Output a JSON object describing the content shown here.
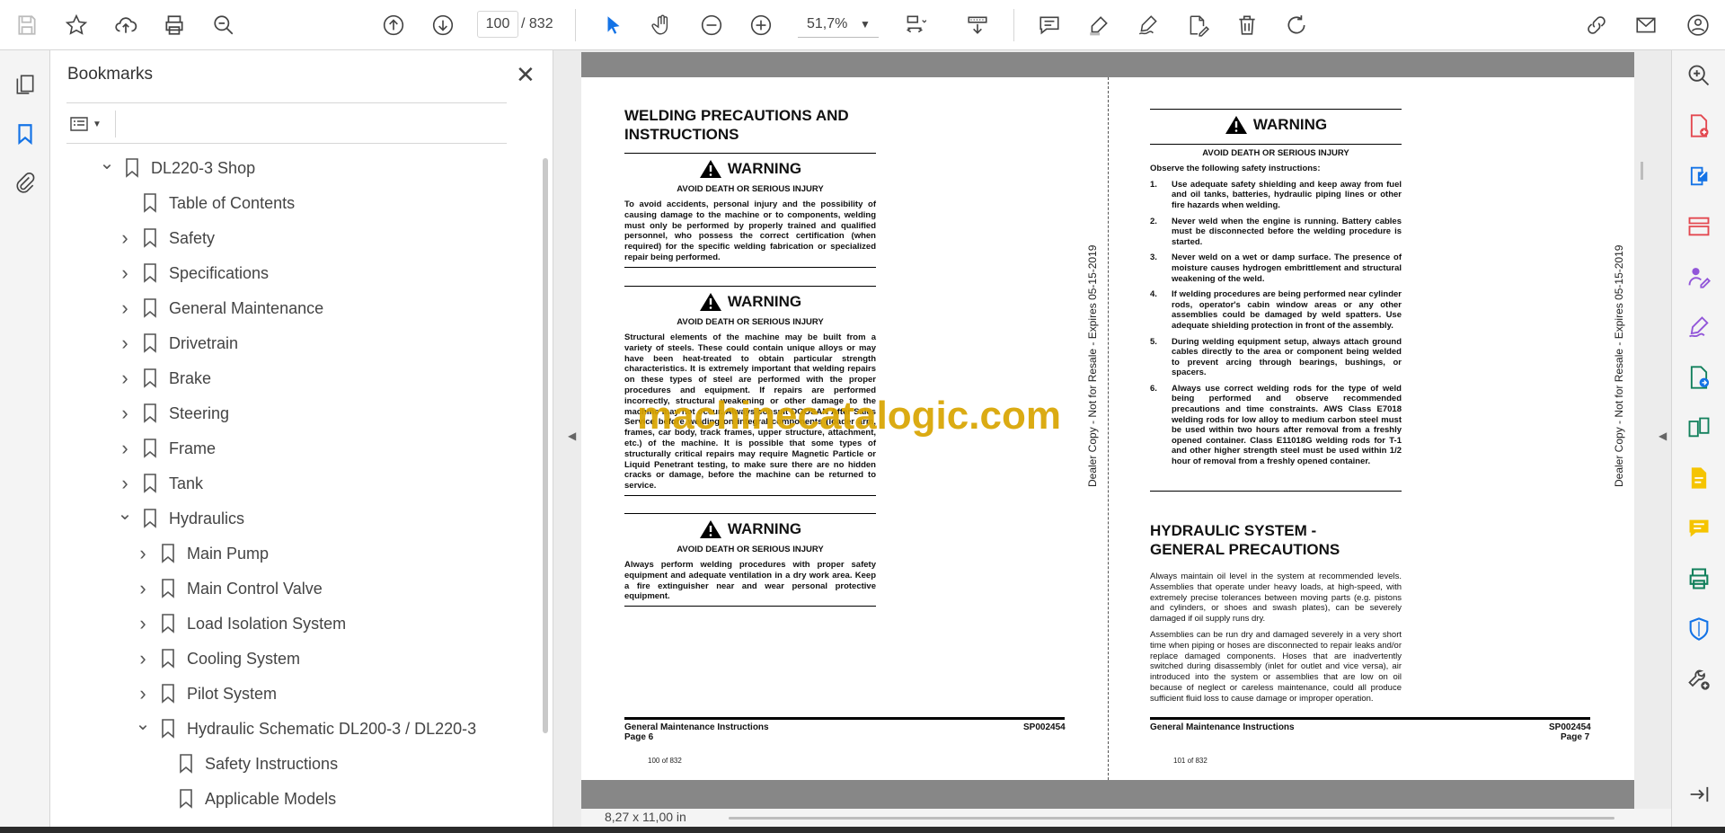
{
  "toolbar": {
    "page_current": "100",
    "page_total": "/ 832",
    "zoom": "51,7%",
    "tools": [
      "save-icon",
      "star-icon",
      "upload-icon",
      "print-icon",
      "zoom-search-icon",
      "prev-page-icon",
      "next-page-icon",
      "select-arrow-icon",
      "hand-icon",
      "zoom-out-icon",
      "zoom-in-icon",
      "fit-page-icon",
      "scroll-mode-icon",
      "comment-icon",
      "highlight-icon",
      "sign-icon",
      "fill-sign-icon",
      "delete-icon",
      "rotate-icon",
      "share-link-icon",
      "mail-icon",
      "account-icon"
    ]
  },
  "bookmarks": {
    "title": "Bookmarks",
    "items": [
      {
        "label": "DL220-3 Shop",
        "level": 0,
        "state": "expanded"
      },
      {
        "label": "Table of Contents",
        "level": 1,
        "state": "leaf"
      },
      {
        "label": "Safety",
        "level": 1,
        "state": "collapsed"
      },
      {
        "label": "Specifications",
        "level": 1,
        "state": "collapsed"
      },
      {
        "label": "General Maintenance",
        "level": 1,
        "state": "collapsed"
      },
      {
        "label": "Drivetrain",
        "level": 1,
        "state": "collapsed"
      },
      {
        "label": "Brake",
        "level": 1,
        "state": "collapsed"
      },
      {
        "label": "Steering",
        "level": 1,
        "state": "collapsed"
      },
      {
        "label": "Frame",
        "level": 1,
        "state": "collapsed"
      },
      {
        "label": "Tank",
        "level": 1,
        "state": "collapsed"
      },
      {
        "label": "Hydraulics",
        "level": 1,
        "state": "expanded"
      },
      {
        "label": "Main Pump",
        "level": 2,
        "state": "collapsed"
      },
      {
        "label": "Main Control Valve",
        "level": 2,
        "state": "collapsed"
      },
      {
        "label": "Load Isolation System",
        "level": 2,
        "state": "collapsed"
      },
      {
        "label": "Cooling System",
        "level": 2,
        "state": "collapsed"
      },
      {
        "label": "Pilot System",
        "level": 2,
        "state": "collapsed"
      },
      {
        "label": "Hydraulic Schematic DL200-3 / DL220-3",
        "level": 2,
        "state": "expanded"
      },
      {
        "label": "Safety Instructions",
        "level": 3,
        "state": "leaf"
      },
      {
        "label": "Applicable Models",
        "level": 3,
        "state": "leaf"
      }
    ]
  },
  "doc": {
    "left": {
      "title_line1": "WELDING PRECAUTIONS AND",
      "title_line2": "INSTRUCTIONS",
      "warnings": [
        {
          "head": "WARNING",
          "sub": "AVOID DEATH OR SERIOUS INJURY",
          "body": "To avoid accidents, personal injury and the possibility of causing damage to the machine or to components, welding must only be performed by properly trained and qualified personnel, who possess the correct certification (when required) for the specific welding fabrication or specialized repair being performed."
        },
        {
          "head": "WARNING",
          "sub": "AVOID DEATH OR SERIOUS INJURY",
          "body": "Structural elements of the machine may be built from a variety of steels. These could contain unique alloys or may have been heat-treated to obtain particular strength characteristics. It is extremely important that welding repairs on these types of steel are performed with the proper procedures and equipment. If repairs are performed incorrectly, structural weakening or other damage to the machine may not occur. Always consult DOOSAN After Sales Service before welding on integral components (loader arm, frames, car body, track frames, upper structure, attachment, etc.) of the machine. It is possible that some types of structurally critical repairs may require Magnetic Particle or Liquid Penetrant testing, to make sure there are no hidden cracks or damage, before the machine can be returned to service."
        },
        {
          "head": "WARNING",
          "sub": "AVOID DEATH OR SERIOUS INJURY",
          "body": "Always perform welding procedures with proper safety equipment and adequate ventilation in a dry work area. Keep a fire extinguisher near and wear personal protective equipment."
        }
      ],
      "footer_left": "General Maintenance Instructions",
      "footer_page": "Page 6",
      "footer_right": "SP002454",
      "page_of": "100 of 832",
      "side_text": "Dealer Copy - Not for Resale - Expires 05-15-2019"
    },
    "right": {
      "warning_head": "WARNING",
      "warning_sub": "AVOID DEATH OR SERIOUS INJURY",
      "intro": "Observe the following safety instructions:",
      "items": [
        {
          "n": "1.",
          "text": "Use adequate safety shielding and keep away from fuel and oil tanks, batteries, hydraulic piping lines or other fire hazards when welding."
        },
        {
          "n": "2.",
          "text": "Never weld when the engine is running. Battery cables must be disconnected before the welding procedure is started."
        },
        {
          "n": "3.",
          "text": "Never weld on a wet or damp surface. The presence of moisture causes hydrogen embrittlement and structural weakening of the weld."
        },
        {
          "n": "4.",
          "text": "If welding procedures are being performed near cylinder rods, operator's cabin window areas or any other assemblies could be damaged by weld spatters. Use adequate shielding protection in front of the assembly."
        },
        {
          "n": "5.",
          "text": "During welding equipment setup, always attach ground cables directly to the area or component being welded to prevent arcing through bearings, bushings, or spacers."
        },
        {
          "n": "6.",
          "text": "Always use correct welding rods for the type of weld being performed and observe recommended precautions and time constraints. AWS Class E7018 welding rods for low alloy to medium carbon steel must be used within two hours after removal from a freshly opened container. Class E11018G welding rods for T-1 and other higher strength steel must be used within 1/2 hour of removal from a freshly opened container."
        }
      ],
      "hyd_title_line1": "HYDRAULIC SYSTEM -",
      "hyd_title_line2": "GENERAL PRECAUTIONS",
      "hyd_p1": "Always maintain oil level in the system at recommended levels. Assemblies that operate under heavy loads, at high-speed, with extremely precise tolerances between moving parts (e.g. pistons and cylinders, or shoes and swash plates), can be severely damaged if oil supply runs dry.",
      "hyd_p2": "Assemblies can be run dry and damaged severely in a very short time when piping or hoses are disconnected to repair leaks and/or replace damaged components. Hoses that are inadvertently switched during disassembly (inlet for outlet and vice versa), air introduced into the system or assemblies that are low on oil because of neglect or careless maintenance, could all produce sufficient fluid loss to cause damage or improper operation.",
      "footer_left": "General Maintenance Instructions",
      "footer_page": "Page 7",
      "footer_right": "SP002454",
      "page_of": "101 of 832",
      "side_text": "Dealer Copy - Not for Resale - Expires 05-15-2019"
    },
    "watermark": "machinecatalogic.com"
  },
  "status": {
    "page_size": "8,27 x 11,00 in"
  },
  "right_tools": [
    "search-zoom-icon",
    "create-pdf-icon",
    "export-pdf-icon",
    "organize-pages-icon",
    "request-signature-icon",
    "fill-sign-icon",
    "send-for-review-icon",
    "compare-icon",
    "edit-pdf-icon",
    "comment-tool-icon",
    "print-production-icon",
    "protect-icon",
    "more-tools-icon",
    "expand-panel-icon"
  ],
  "colors": {
    "accent": "#1473e6",
    "watermark": "#d9a400",
    "page_gray": "#878787"
  }
}
